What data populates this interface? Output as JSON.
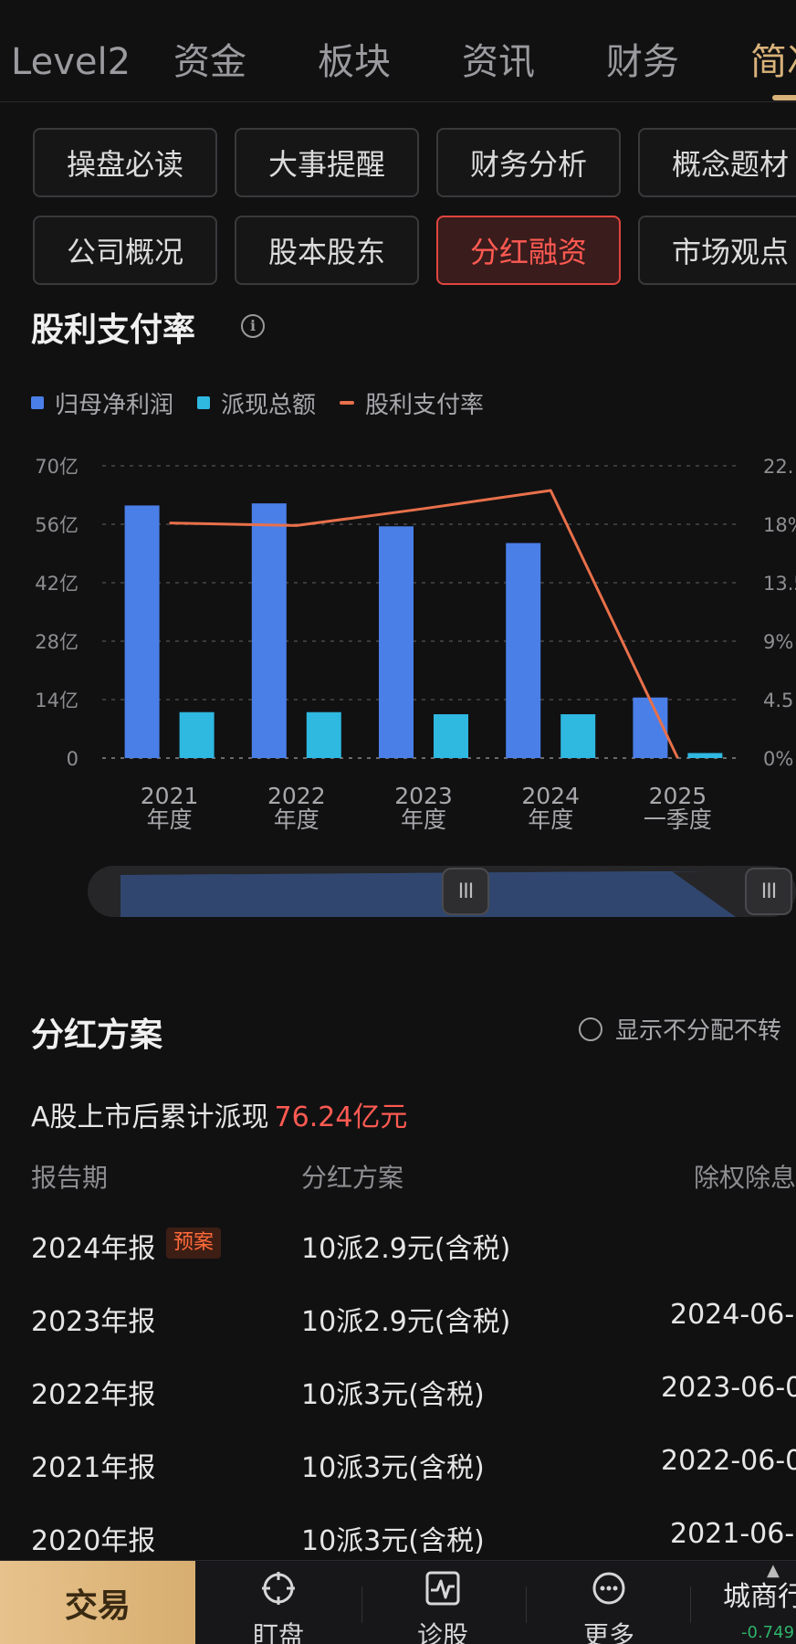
{
  "top_tabs": [
    {
      "label": "Level2"
    },
    {
      "label": "资金"
    },
    {
      "label": "板块"
    },
    {
      "label": "资讯"
    },
    {
      "label": "财务"
    },
    {
      "label": "简况",
      "active": true
    }
  ],
  "quick_buttons": [
    {
      "label": "操盘必读"
    },
    {
      "label": "大事提醒"
    },
    {
      "label": "财务分析"
    },
    {
      "label": "概念题材"
    },
    {
      "label": "公司概况"
    },
    {
      "label": "股本股东"
    },
    {
      "label": "分红融资",
      "active": true
    },
    {
      "label": "市场观点"
    }
  ],
  "payout_section": {
    "title": "股利支付率",
    "info_icon": "info-icon"
  },
  "chart_data": {
    "type": "bar",
    "categories": [
      "2021\n年度",
      "2022\n年度",
      "2023\n年度",
      "2024\n年度",
      "2025\n一季度"
    ],
    "series": [
      {
        "name": "归母净利润",
        "type": "bar",
        "axis": "left",
        "color": "#4a7fe8",
        "values": [
          60.5,
          61,
          55.5,
          51.5,
          14.5
        ]
      },
      {
        "name": "派现总额",
        "type": "bar",
        "axis": "left",
        "color": "#2fb8e0",
        "values": [
          11,
          11,
          10.5,
          10.5,
          1.2
        ]
      },
      {
        "name": "股利支付率",
        "type": "line",
        "axis": "right",
        "color": "#e8704a",
        "values": [
          18.1,
          17.9,
          19.2,
          20.6,
          0
        ]
      }
    ],
    "left_axis": {
      "ticks": [
        "0",
        "14亿",
        "28亿",
        "42亿",
        "56亿",
        "70亿"
      ],
      "ylim": [
        0,
        70
      ]
    },
    "right_axis": {
      "ticks": [
        "0%",
        "4.5",
        "9%",
        "13.5",
        "18%",
        "22."
      ],
      "ylim": [
        0,
        22.5
      ]
    },
    "grid": true,
    "legend_position": "top-left"
  },
  "range_slider": {
    "handle_glyph": "III"
  },
  "dividend_section": {
    "title": "分红方案",
    "toggle_label": "显示不分配不转",
    "cumulative_label": "A股上市后累计派现",
    "cumulative_value": "76.24亿元",
    "columns": [
      "报告期",
      "分红方案",
      "除权除息"
    ],
    "rows": [
      {
        "period": "2024年报",
        "badge": "预案",
        "plan": "10派2.9元(含税)",
        "exdate": ""
      },
      {
        "period": "2023年报",
        "badge": "",
        "plan": "10派2.9元(含税)",
        "exdate": "2024-06-"
      },
      {
        "period": "2022年报",
        "badge": "",
        "plan": "10派3元(含税)",
        "exdate": "2023-06-0"
      },
      {
        "period": "2021年报",
        "badge": "",
        "plan": "10派3元(含税)",
        "exdate": "2022-06-0"
      },
      {
        "period": "2020年报",
        "badge": "",
        "plan": "10派3元(含税)",
        "exdate": "2021-06-"
      }
    ]
  },
  "bottom_bar": {
    "trade_label": "交易",
    "nav": [
      {
        "label": "盯盘",
        "icon": "crosshair-icon"
      },
      {
        "label": "诊股",
        "icon": "pulse-chart-icon"
      },
      {
        "label": "更多",
        "icon": "more-icon"
      }
    ],
    "stock_name": "城商行",
    "stock_change": "-0.749"
  }
}
